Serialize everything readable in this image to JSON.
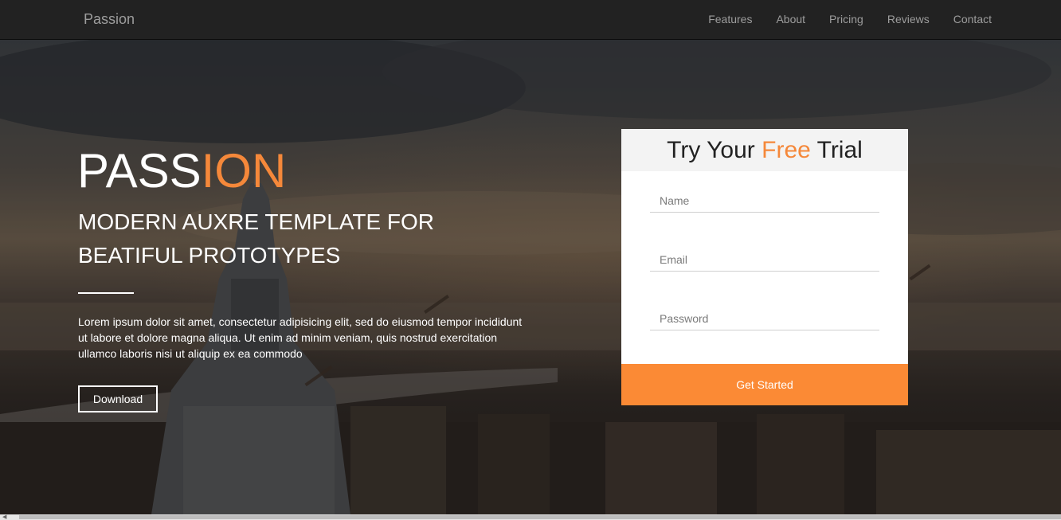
{
  "nav": {
    "brand": "Passion",
    "links": [
      "Features",
      "About",
      "Pricing",
      "Reviews",
      "Contact"
    ]
  },
  "hero": {
    "title_main": "PASS",
    "title_accent": "ION",
    "subtitle_line1": "MODERN AUXRE TEMPLATE FOR",
    "subtitle_line2": "BEATIFUL PROTOTYPES",
    "body": "Lorem ipsum dolor sit amet, consectetur adipisicing elit, sed do eiusmod tempor incididunt ut labore et dolore magna aliqua. Ut enim ad minim veniam, quis nostrud exercitation ullamco laboris nisi ut aliquip ex ea commodo",
    "download_label": "Download"
  },
  "form": {
    "title_before": "Try Your ",
    "title_accent": "Free",
    "title_after": " Trial",
    "name_placeholder": "Name",
    "email_placeholder": "Email",
    "password_placeholder": "Password",
    "submit_label": "Get Started"
  },
  "colors": {
    "accent": "#f5883a",
    "button": "#fb8a35",
    "navbar": "#222222"
  },
  "icons": {
    "scroll_left": "scroll-left-arrow-icon"
  }
}
